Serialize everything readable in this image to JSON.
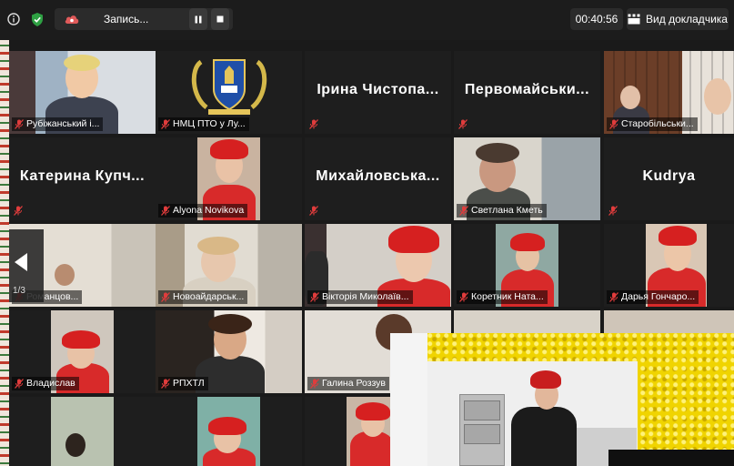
{
  "toolbar": {
    "recording_label": "Запись...",
    "timer": "00:40:56",
    "view_label": "Вид докладчика"
  },
  "tiles": [
    {
      "label": "Рубіжанський і..."
    },
    {
      "label": "НМЦ ПТО у Лу..."
    },
    {
      "name": "Ірина  Чистопа..."
    },
    {
      "name": "Первомайськи..."
    },
    {
      "label": "Старобільськи..."
    },
    {
      "name": "Катерина  Купч..."
    },
    {
      "label": "Alyona Novikova"
    },
    {
      "name": "Михайловська..."
    },
    {
      "label": "Светлана Кметь"
    },
    {
      "name": "Kudrya"
    },
    {
      "label": "Романцов..."
    },
    {
      "label": "Новоайдарськ..."
    },
    {
      "label": "Вікторія Миколаїв..."
    },
    {
      "label": "Коретник Ната..."
    },
    {
      "label": "Дарья Гончаро..."
    },
    {
      "label": "Владислав"
    },
    {
      "label": "РПХТЛ"
    },
    {
      "label": "Галина Роззув"
    }
  ],
  "pager": {
    "text": "1/3"
  },
  "colors": {
    "active_speaker": "#c8e64a",
    "muted_mic": "#e03c3c",
    "chef_hat": "#d62020"
  },
  "icons": [
    "info-icon",
    "shield-icon",
    "cloud-record-icon",
    "pause-icon",
    "stop-icon",
    "speaker-view-icon",
    "mic-muted-icon",
    "chevron-left-icon"
  ]
}
